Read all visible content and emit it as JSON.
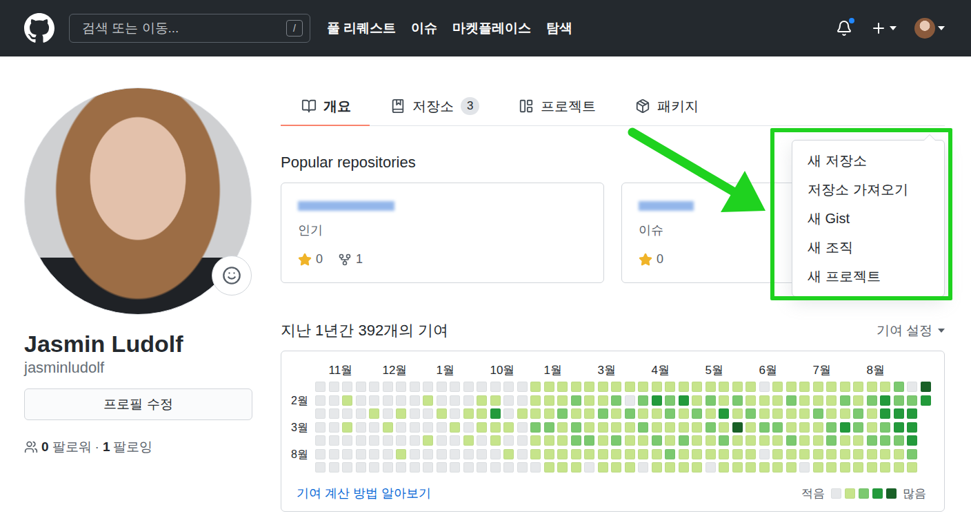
{
  "header": {
    "search": {
      "placeholder": "검색 또는 이동...",
      "shortcut": "/"
    },
    "nav": [
      "풀 리퀘스트",
      "이슈",
      "마켓플레이스",
      "탐색"
    ],
    "notifications": {
      "unread": true
    }
  },
  "tabs": [
    {
      "label": "개요",
      "selected": true
    },
    {
      "label": "저장소",
      "count": "3",
      "selected": false
    },
    {
      "label": "프로젝트",
      "selected": false
    },
    {
      "label": "패키지",
      "selected": false
    }
  ],
  "profile": {
    "name": "Jasmin Ludolf",
    "username": "jasminludolf",
    "edit_button": "프로필 수정",
    "followers": {
      "count": "0",
      "label": "팔로워"
    },
    "separator": "·",
    "following": {
      "count": "1",
      "label": "팔로잉"
    }
  },
  "popular": {
    "title": "Popular repositories",
    "repos": [
      {
        "description": "인기",
        "stars": "0",
        "forks": "1"
      },
      {
        "description": "이슈",
        "stars": "0"
      }
    ]
  },
  "menu": {
    "open": true,
    "items": [
      "새 저장소",
      "저장소 가져오기",
      "새 Gist",
      "새 조직",
      "새 프로젝트"
    ]
  },
  "contributions": {
    "title": "지난 1년간 392개의 기여",
    "settings": "기여 설정",
    "months": [
      "11월",
      "12월",
      "1월",
      "10월",
      "1월",
      "3월",
      "4월",
      "5월",
      "6월",
      "7월",
      "8월"
    ],
    "day_labels": [
      "2월",
      "3월",
      "8월"
    ],
    "weeks": [
      [
        0,
        0,
        0,
        0,
        0,
        0,
        0
      ],
      [
        0,
        0,
        0,
        0,
        0,
        0,
        0
      ],
      [
        0,
        1,
        0,
        1,
        0,
        0,
        0
      ],
      [
        0,
        0,
        0,
        0,
        0,
        0,
        0
      ],
      [
        0,
        0,
        1,
        0,
        0,
        0,
        0
      ],
      [
        0,
        0,
        0,
        1,
        0,
        0,
        0
      ],
      [
        0,
        0,
        1,
        0,
        0,
        1,
        0
      ],
      [
        0,
        0,
        0,
        0,
        0,
        0,
        0
      ],
      [
        0,
        1,
        0,
        0,
        1,
        0,
        0
      ],
      [
        0,
        0,
        1,
        0,
        0,
        0,
        0
      ],
      [
        0,
        0,
        0,
        1,
        0,
        0,
        0
      ],
      [
        0,
        0,
        1,
        0,
        1,
        0,
        0
      ],
      [
        0,
        1,
        1,
        1,
        0,
        0,
        0
      ],
      [
        0,
        1,
        3,
        1,
        1,
        0,
        0
      ],
      [
        0,
        0,
        0,
        1,
        0,
        1,
        0
      ],
      [
        0,
        0,
        1,
        0,
        0,
        0,
        0
      ],
      [
        1,
        1,
        1,
        2,
        1,
        1,
        0
      ],
      [
        1,
        1,
        1,
        2,
        1,
        1,
        1
      ],
      [
        1,
        1,
        2,
        1,
        1,
        1,
        1
      ],
      [
        1,
        2,
        1,
        2,
        2,
        1,
        1
      ],
      [
        1,
        1,
        1,
        1,
        2,
        1,
        0
      ],
      [
        1,
        1,
        2,
        1,
        1,
        1,
        1
      ],
      [
        1,
        2,
        1,
        1,
        2,
        1,
        1
      ],
      [
        1,
        0,
        2,
        1,
        1,
        1,
        1
      ],
      [
        1,
        2,
        1,
        2,
        1,
        1,
        0
      ],
      [
        1,
        3,
        1,
        1,
        2,
        1,
        1
      ],
      [
        1,
        2,
        2,
        1,
        1,
        2,
        1
      ],
      [
        1,
        3,
        1,
        1,
        2,
        1,
        1
      ],
      [
        1,
        1,
        2,
        1,
        1,
        1,
        1
      ],
      [
        1,
        2,
        1,
        2,
        1,
        1,
        0
      ],
      [
        1,
        1,
        3,
        1,
        2,
        1,
        1
      ],
      [
        1,
        2,
        1,
        4,
        1,
        1,
        1
      ],
      [
        1,
        1,
        2,
        1,
        1,
        1,
        1
      ],
      [
        0,
        1,
        1,
        2,
        1,
        0,
        1
      ],
      [
        1,
        1,
        1,
        2,
        1,
        1,
        1
      ],
      [
        1,
        2,
        1,
        1,
        2,
        1,
        1
      ],
      [
        1,
        1,
        1,
        1,
        1,
        1,
        0
      ],
      [
        1,
        1,
        2,
        1,
        1,
        1,
        1
      ],
      [
        1,
        1,
        1,
        2,
        2,
        1,
        1
      ],
      [
        1,
        2,
        1,
        3,
        1,
        1,
        1
      ],
      [
        1,
        1,
        2,
        2,
        1,
        1,
        1
      ],
      [
        1,
        2,
        1,
        1,
        2,
        1,
        1
      ],
      [
        1,
        3,
        3,
        2,
        2,
        1,
        1
      ],
      [
        2,
        2,
        3,
        3,
        2,
        1,
        1
      ],
      [
        0,
        2,
        3,
        3,
        3,
        2,
        1
      ],
      [
        4,
        3
      ]
    ],
    "help_link": "기여 계산 방법 알아보기",
    "legend": {
      "less": "적음",
      "more": "많음",
      "levels": [
        0,
        1,
        2,
        3,
        4
      ]
    }
  }
}
